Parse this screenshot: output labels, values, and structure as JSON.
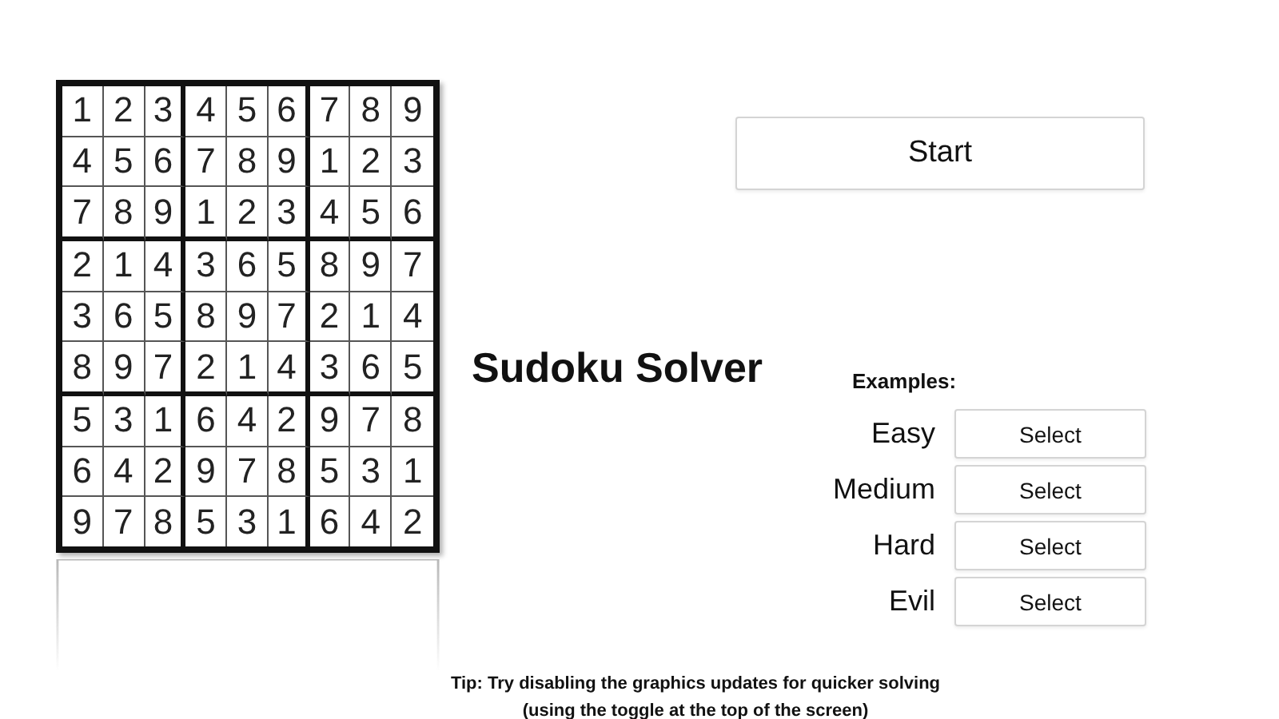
{
  "puzzle": {
    "rows": [
      [
        "1",
        "2",
        "3",
        "4",
        "5",
        "6",
        "7",
        "8",
        "9"
      ],
      [
        "4",
        "5",
        "6",
        "7",
        "8",
        "9",
        "1",
        "2",
        "3"
      ],
      [
        "7",
        "8",
        "9",
        "1",
        "2",
        "3",
        "4",
        "5",
        "6"
      ],
      [
        "2",
        "1",
        "4",
        "3",
        "6",
        "5",
        "8",
        "9",
        "7"
      ],
      [
        "3",
        "6",
        "5",
        "8",
        "9",
        "7",
        "2",
        "1",
        "4"
      ],
      [
        "8",
        "9",
        "7",
        "2",
        "1",
        "4",
        "3",
        "6",
        "5"
      ],
      [
        "5",
        "3",
        "1",
        "6",
        "4",
        "2",
        "9",
        "7",
        "8"
      ],
      [
        "6",
        "4",
        "2",
        "9",
        "7",
        "8",
        "5",
        "3",
        "1"
      ],
      [
        "9",
        "7",
        "8",
        "5",
        "3",
        "1",
        "6",
        "4",
        "2"
      ]
    ]
  },
  "title": "Sudoku Solver",
  "start_button": "Start",
  "examples": {
    "heading": "Examples:",
    "items": [
      {
        "label": "Easy",
        "button": "Select"
      },
      {
        "label": "Medium",
        "button": "Select"
      },
      {
        "label": "Hard",
        "button": "Select"
      },
      {
        "label": "Evil",
        "button": "Select"
      }
    ]
  },
  "tip": [
    "Tip: Try disabling the graphics updates for quicker solving",
    "(using the toggle at the top of the screen)"
  ]
}
